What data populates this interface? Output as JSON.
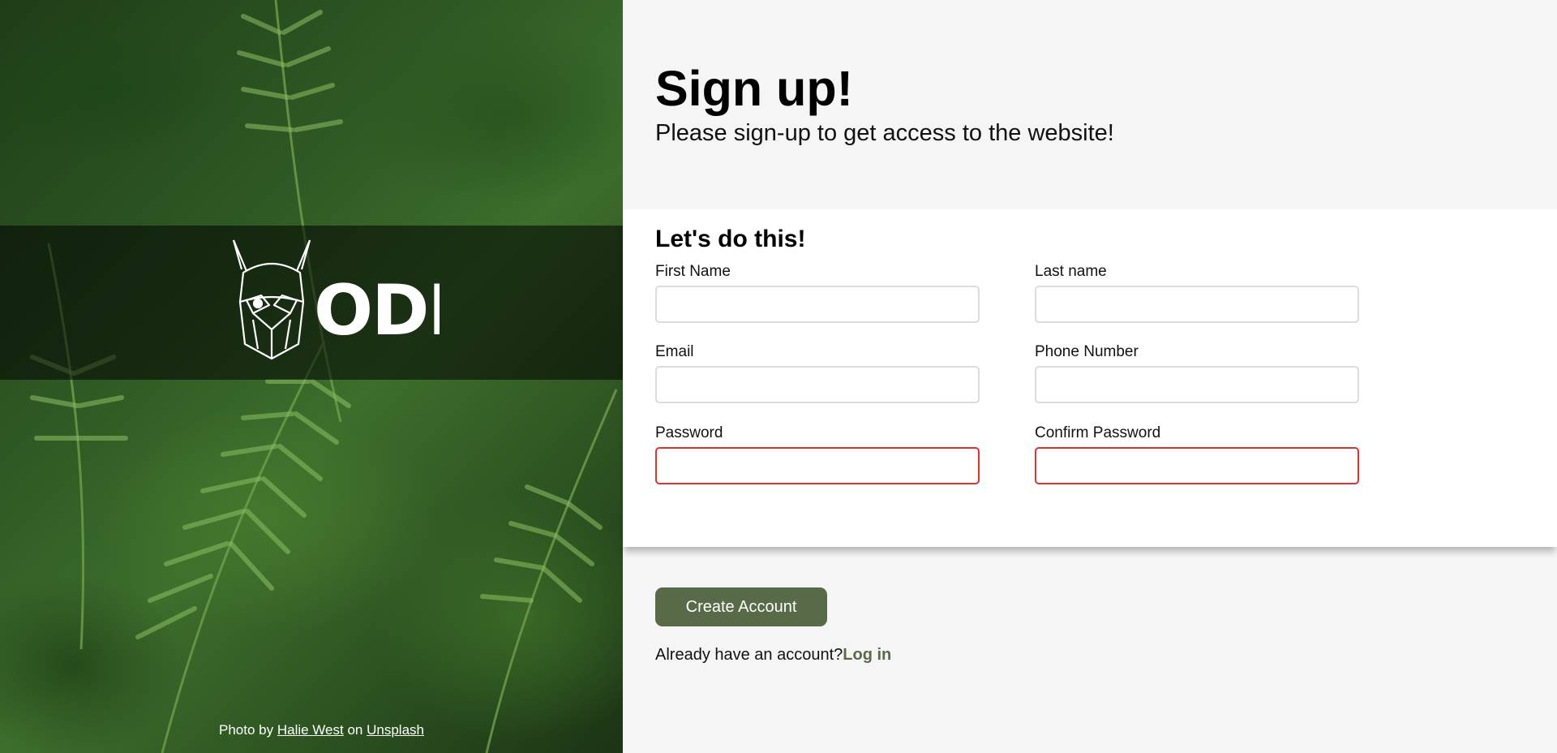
{
  "hero": {
    "logo_icon": "odin-viking-helmet-logo",
    "logo_text": "ODIN",
    "credit": {
      "prefix": "Photo by",
      "author": "Halie West",
      "middle": "on",
      "source": "Unsplash"
    }
  },
  "header": {
    "title": "Sign up!",
    "subtitle": "Please sign-up to get access to the website!"
  },
  "form": {
    "title": "Let's do this!",
    "fields": {
      "first_name": {
        "label": "First Name",
        "value": "",
        "placeholder": ""
      },
      "last_name": {
        "label": "Last name",
        "value": "",
        "placeholder": ""
      },
      "email": {
        "label": "Email",
        "value": "",
        "placeholder": ""
      },
      "phone": {
        "label": "Phone Number",
        "value": "",
        "placeholder": ""
      },
      "password": {
        "label": "Password",
        "value": "",
        "placeholder": ""
      },
      "confirm_password": {
        "label": "Confirm Password",
        "value": "",
        "placeholder": ""
      }
    },
    "invalid_border_color": "#e03131"
  },
  "actions": {
    "create_label": "Create Account",
    "login_prompt": "Already have an account?",
    "login_link": "Log in"
  },
  "colors": {
    "accent": "#596a48",
    "panel_bg": "#f5f5f5",
    "card_bg": "#ffffff"
  }
}
